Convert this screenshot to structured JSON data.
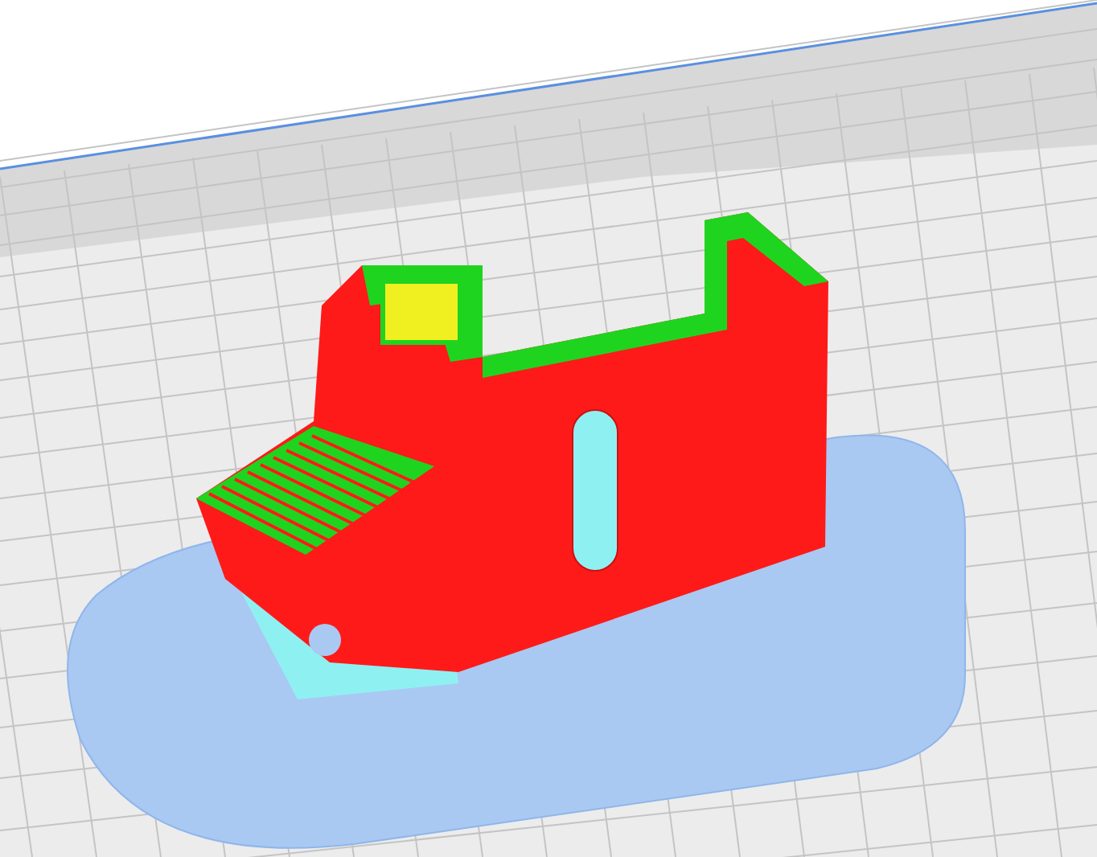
{
  "scene": {
    "kind": "layer-preview"
  }
}
